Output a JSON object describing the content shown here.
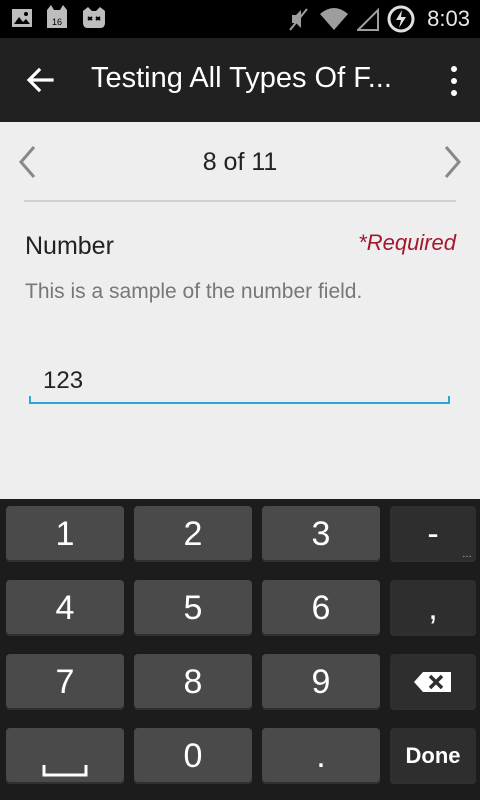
{
  "status_bar": {
    "time": "8:03"
  },
  "app_bar": {
    "title": "Testing All Types Of F..."
  },
  "pager": {
    "page_count": "8 of 11"
  },
  "field": {
    "label": "Number",
    "required": "*Required",
    "hint": "This is a sample of the number field.",
    "value": "123"
  },
  "keyboard": {
    "rows": [
      [
        "1",
        "2",
        "3",
        "-"
      ],
      [
        "4",
        "5",
        "6",
        ","
      ],
      [
        "7",
        "8",
        "9",
        ""
      ],
      [
        "",
        "0",
        ".",
        "Done"
      ]
    ]
  },
  "colors": {
    "accent": "#2aa6d8",
    "required": "#a3182d",
    "app_bar": "#212121",
    "content_bg": "#eeeeee"
  },
  "icons": [
    "image-icon",
    "android-16-icon",
    "cyanogen-icon",
    "muted-icon",
    "wifi-icon",
    "signal-icon",
    "battery-charging-icon",
    "back-arrow-icon",
    "overflow-menu-icon",
    "chevron-left-icon",
    "chevron-right-icon",
    "backspace-icon",
    "space-icon"
  ]
}
